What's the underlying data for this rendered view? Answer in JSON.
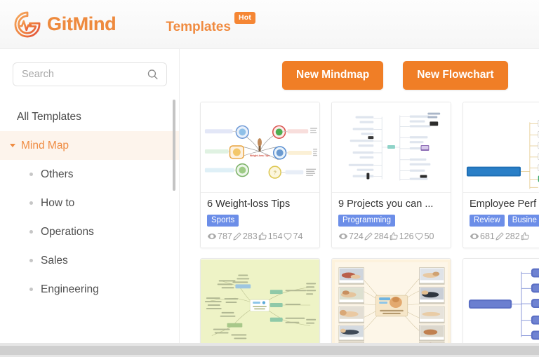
{
  "header": {
    "logo_icon": "gitmind-pulse-logo-icon",
    "brand": "GitMind",
    "nav_label": "Templates",
    "hot_badge": "Hot",
    "brand_color": "#ee8a3e",
    "accent_color": "#f07e26"
  },
  "sidebar": {
    "search": {
      "placeholder": "Search",
      "value": "",
      "icon": "search-icon"
    },
    "all_templates": "All Templates",
    "category": {
      "label": "Mind Map",
      "expanded": true,
      "caret_icon": "caret-down-icon"
    },
    "sub_items": [
      {
        "label": "Others"
      },
      {
        "label": "How to"
      },
      {
        "label": "Operations"
      },
      {
        "label": "Sales"
      },
      {
        "label": "Engineering"
      }
    ]
  },
  "toolbar": {
    "new_mindmap": "New Mindmap",
    "new_flowchart": "New Flowchart"
  },
  "templates": {
    "row1": [
      {
        "title": "6 Weight-loss Tips",
        "tags": [
          "Sports"
        ],
        "stats": {
          "views": "787",
          "edits": "283",
          "likes": "154",
          "favorites": "74"
        },
        "thumb": "radial-mindmap-weightloss"
      },
      {
        "title": "9 Projects you can ...",
        "tags": [
          "Programming"
        ],
        "stats": {
          "views": "724",
          "edits": "284",
          "likes": "126",
          "favorites": "50"
        },
        "thumb": "two-sided-tree-programming"
      },
      {
        "title": "Employee Perf",
        "tags": [
          "Review",
          "Busine"
        ],
        "stats": {
          "views": "681",
          "edits": "282",
          "likes": "",
          "favorites": ""
        },
        "thumb": "org-tree-employee-review"
      }
    ],
    "row2": [
      {
        "thumb": "green-mindmap"
      },
      {
        "thumb": "yoga-photo-mindmap"
      },
      {
        "thumb": "blue-tree-chart"
      }
    ]
  },
  "icons": {
    "views": "eye-icon",
    "edits": "pencil-icon",
    "likes": "thumbs-up-icon",
    "favorites": "heart-icon"
  }
}
